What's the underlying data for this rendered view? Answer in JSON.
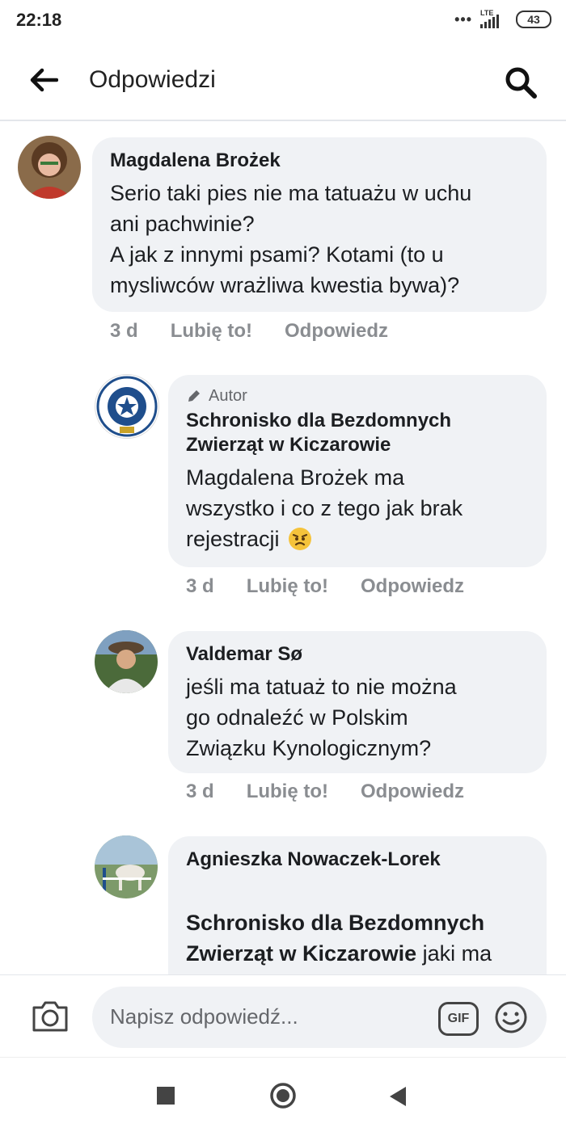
{
  "status_bar": {
    "time": "22:18",
    "signal_label": "LTE",
    "battery": "43"
  },
  "header": {
    "title": "Odpowiedzi"
  },
  "comments": [
    {
      "name": "Magdalena Brożek",
      "text": "Serio taki pies nie ma tatuażu w uchu\nani pachwinie?\nA jak z innymi psami? Kotami (to u\nmysliwców wrażliwa kwestia bywa)?",
      "time": "3 d",
      "like": "Lubię to!",
      "reply": "Odpowiedz"
    },
    {
      "badge": "Autor",
      "name": "Schronisko dla Bezdomnych Zwierząt w Kiczarowie",
      "text": "Magdalena Brożek  ma\nwszystko i co z tego jak brak\nrejestracji",
      "time": "3 d",
      "like": "Lubię to!",
      "reply": "Odpowiedz"
    },
    {
      "name": "Valdemar Sø",
      "text": "jeśli ma tatuaż to nie można\ngo odnaleźć w Polskim\nZwiązku Kynologicznym?",
      "time": "3 d",
      "like": "Lubię to!",
      "reply": "Odpowiedz"
    },
    {
      "name": "Agnieszka Nowaczek-Lorek",
      "mention": "Schronisko dla Bezdomnych\nZwierząt w Kiczarowie",
      "text": " jaki ma\nnumer tatuaża?"
    }
  ],
  "composer": {
    "placeholder": "Napisz odpowiedź...",
    "gif": "GIF"
  },
  "colors": {
    "bubble": "#f0f2f5",
    "meta_text": "#8a8d91",
    "text": "#1c1e21"
  }
}
